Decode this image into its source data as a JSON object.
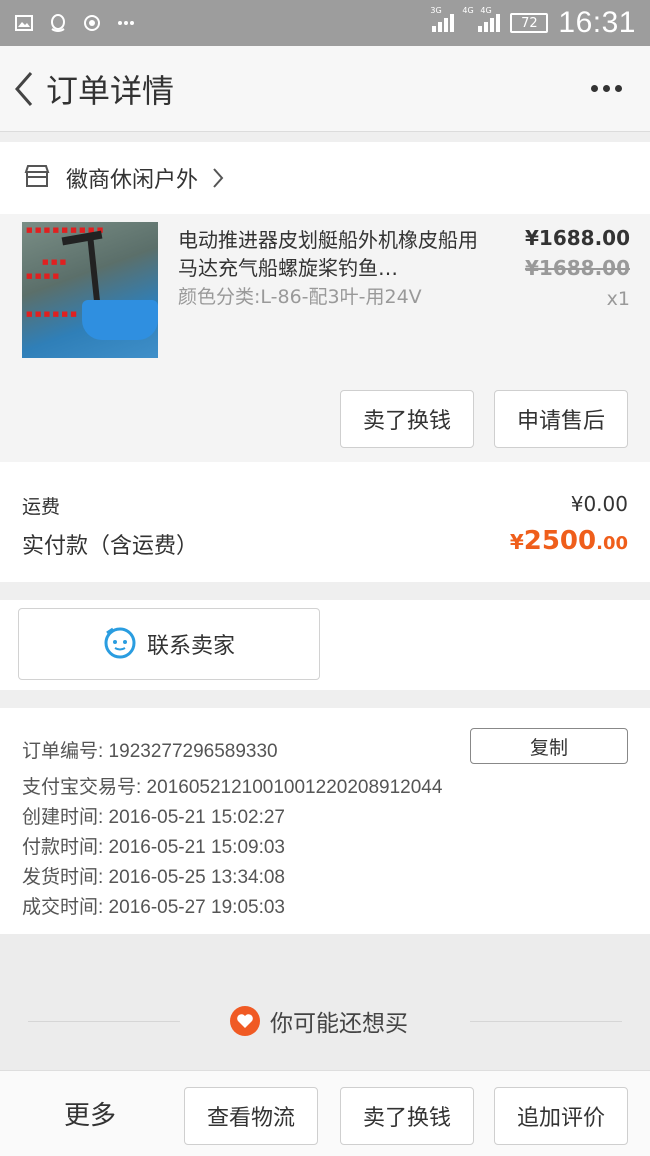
{
  "status_bar": {
    "net1": "3G",
    "net2": "4G",
    "net3": "4G",
    "battery": "72",
    "time": "16:31",
    "icons": [
      "image-icon",
      "qq-icon",
      "record-icon",
      "ellipsis-icon"
    ]
  },
  "header": {
    "title": "订单详情"
  },
  "shop": {
    "name": "徽商休闲户外"
  },
  "product": {
    "title": "电动推进器皮划艇船外机橡皮船用马达充气船螺旋桨钓鱼…",
    "sku": "颜色分类:L-86-配3叶-用24V",
    "price": "¥1688.00",
    "original_price": "¥1688.00",
    "quantity": "x1"
  },
  "product_actions": {
    "sell_label": "卖了换钱",
    "aftersale_label": "申请售后"
  },
  "fees": {
    "shipping_label": "运费",
    "shipping_value": "¥0.00",
    "paid_label": "实付款（含运费）",
    "paid_symbol": "¥",
    "paid_integer": "2500",
    "paid_decimal": ".00"
  },
  "contact": {
    "label": "联系卖家"
  },
  "order_info": {
    "order_no": "订单编号: 1923277296589330",
    "copy_label": "复制",
    "alipay_no": "支付宝交易号: 2016052121001001220208912044",
    "created": "创建时间: 2016-05-21 15:02:27",
    "paid": "付款时间: 2016-05-21 15:09:03",
    "shipped": "发货时间: 2016-05-25 13:34:08",
    "closed": "成交时间: 2016-05-27 19:05:03"
  },
  "recommend": {
    "title": "你可能还想买"
  },
  "bottom_bar": {
    "more": "更多",
    "logistics": "查看物流",
    "sell": "卖了换钱",
    "review": "追加评价"
  },
  "colors": {
    "accent": "#ef5e1b",
    "contact_icon": "#2a9de0",
    "status_bar": "#9d9d9d"
  }
}
